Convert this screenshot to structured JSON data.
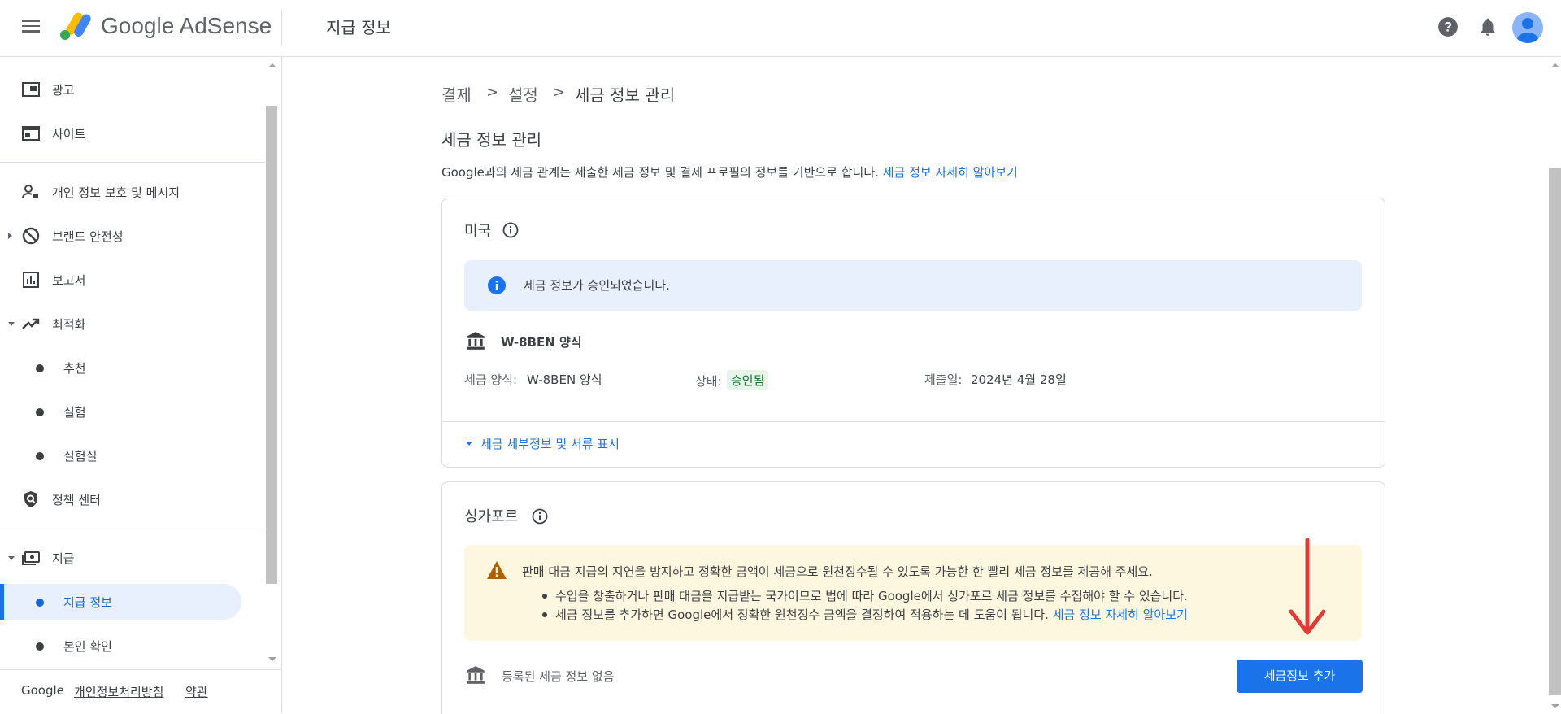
{
  "header": {
    "brand": "Google AdSense",
    "page_title": "지급 정보",
    "icons": [
      "menu-icon",
      "adsense-logo",
      "help-icon",
      "notifications-icon",
      "account-avatar"
    ]
  },
  "sidebar": {
    "items": [
      {
        "label": "광고",
        "icon": "ads-icon"
      },
      {
        "label": "사이트",
        "icon": "sites-icon"
      },
      {
        "label": "개인 정보 보호 및 메시지",
        "icon": "privacy-icon"
      },
      {
        "label": "브랜드 안전성",
        "icon": "block-icon"
      },
      {
        "label": "보고서",
        "icon": "reports-icon"
      },
      {
        "label": "최적화",
        "icon": "trending-icon"
      },
      {
        "label": "추천"
      },
      {
        "label": "실험"
      },
      {
        "label": "실험실"
      },
      {
        "label": "정책 센터",
        "icon": "policy-icon"
      },
      {
        "label": "지급",
        "icon": "payments-icon"
      },
      {
        "label": "지급 정보",
        "active": true
      },
      {
        "label": "본인 확인"
      }
    ],
    "footer": {
      "brand": "Google",
      "privacy": "개인정보처리방침",
      "terms": "약관"
    }
  },
  "breadcrumb": {
    "items": [
      "결제",
      "설정",
      "세금 정보 관리"
    ],
    "separator": ">"
  },
  "main": {
    "title": "세금 정보 관리",
    "intro": "Google과의 세금 관계는 제출한 세금 정보 및 결제 프로필의 정보를 기반으로 합니다.",
    "intro_link": "세금 정보 자세히 알아보기",
    "us_card": {
      "title": "미국",
      "banner": "세금 정보가 승인되었습니다.",
      "form_name": "W-8BEN 양식",
      "form_type_label": "세금 양식:",
      "form_type_value": "W-8BEN 양식",
      "status_label": "상태:",
      "status_value": "승인됨",
      "submitted_label": "제출일:",
      "submitted_value": "2024년 4월 28일",
      "expand_link": "세금 세부정보 및 서류 표시"
    },
    "sg_card": {
      "title": "싱가포르",
      "warning": "판매 대금 지급의 지연을 방지하고 정확한 금액이 세금으로 원천징수될 수 있도록 가능한 한 빨리 세금 정보를 제공해 주세요.",
      "bullets": [
        "수입을 창출하거나 판매 대금을 지급받는 국가이므로 법에 따라 Google에서 싱가포르 세금 정보를 수집해야 할 수 있습니다.",
        "세금 정보를 추가하면 Google에서 정확한 원천징수 금액을 결정하여 적용하는 데 도움이 됩니다."
      ],
      "bullet_link": "세금 정보 자세히 알아보기",
      "empty_text": "등록된 세금 정보 없음",
      "add_button": "세금정보 추가"
    }
  },
  "colors": {
    "accent": "#1a73e8",
    "warning": "#e37400",
    "annotation": "#e53935",
    "success": "#137333"
  }
}
